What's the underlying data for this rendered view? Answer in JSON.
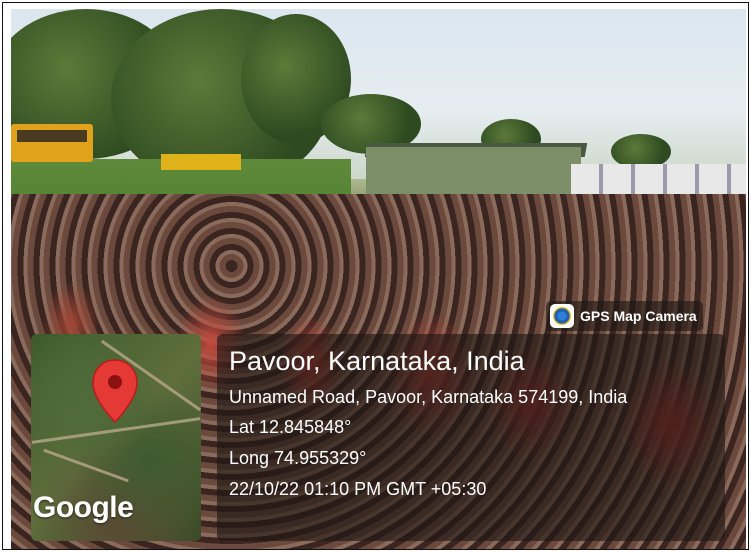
{
  "photo": {
    "description_colors": {
      "accent": "#c24a3f",
      "overlay": "#1e1614"
    }
  },
  "badge": {
    "app_name": "GPS Map Camera",
    "icon": "camera-lens-icon"
  },
  "map": {
    "brand": "Google",
    "pin_icon": "map-pin-icon",
    "pin_color": "#e53935"
  },
  "location": {
    "title": "Pavoor, Karnataka, India",
    "address": "Unnamed Road, Pavoor, Karnataka 574199, India",
    "lat": "Lat 12.845848°",
    "long": "Long 74.955329°",
    "datetime": "22/10/22 01:10 PM GMT +05:30"
  }
}
